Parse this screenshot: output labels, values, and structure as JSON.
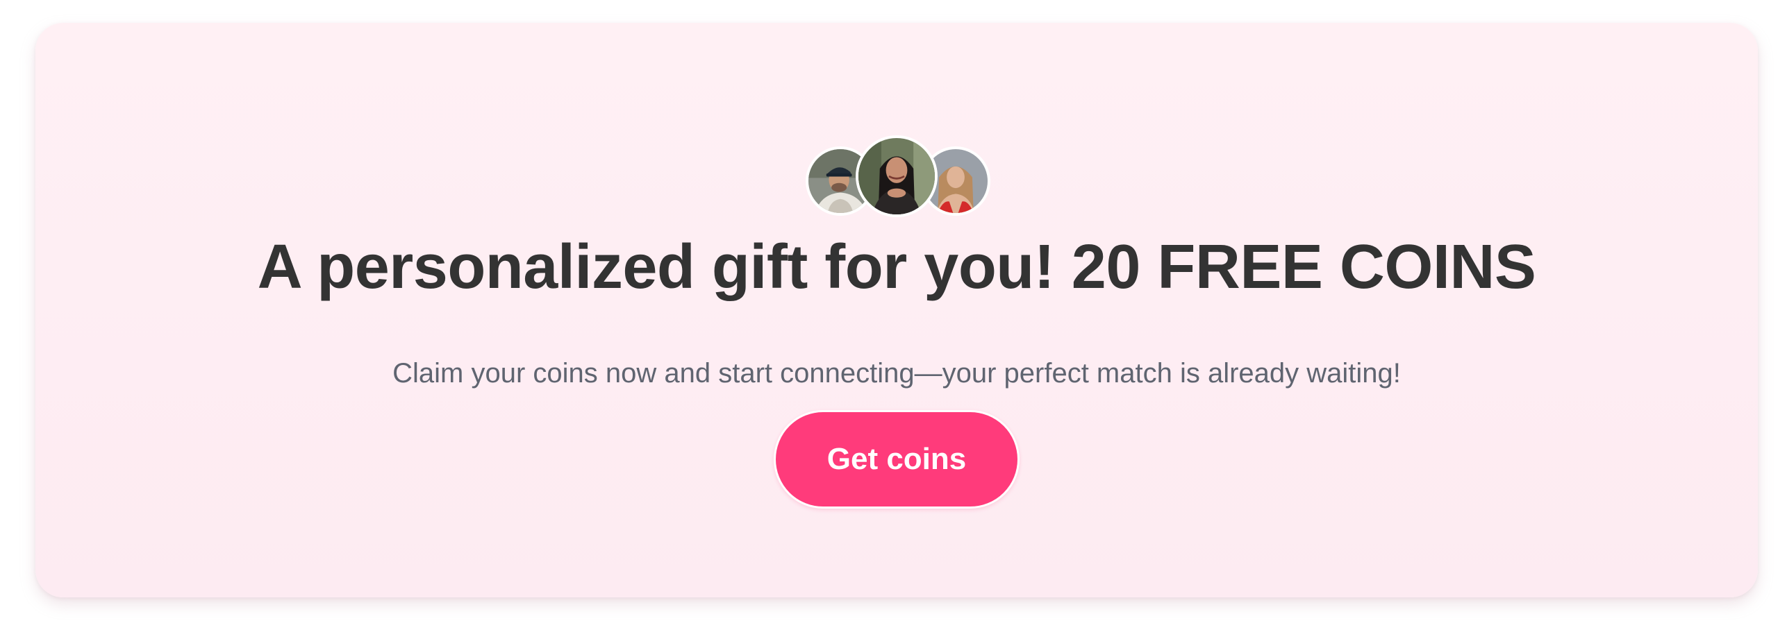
{
  "promo": {
    "headline": "A personalized gift for you! 20 FREE COINS",
    "subtitle": "Claim your coins now and start connecting—your perfect match is already waiting!",
    "cta_label": "Get coins"
  },
  "avatars": [
    {
      "name": "avatar-man-cap"
    },
    {
      "name": "avatar-woman-dark-hair"
    },
    {
      "name": "avatar-woman-blonde"
    }
  ],
  "colors": {
    "card_background": "#fdedf2",
    "accent": "#ff3b7b",
    "headline_text": "#333333",
    "subtitle_text": "#5f6470",
    "button_text": "#ffffff"
  }
}
